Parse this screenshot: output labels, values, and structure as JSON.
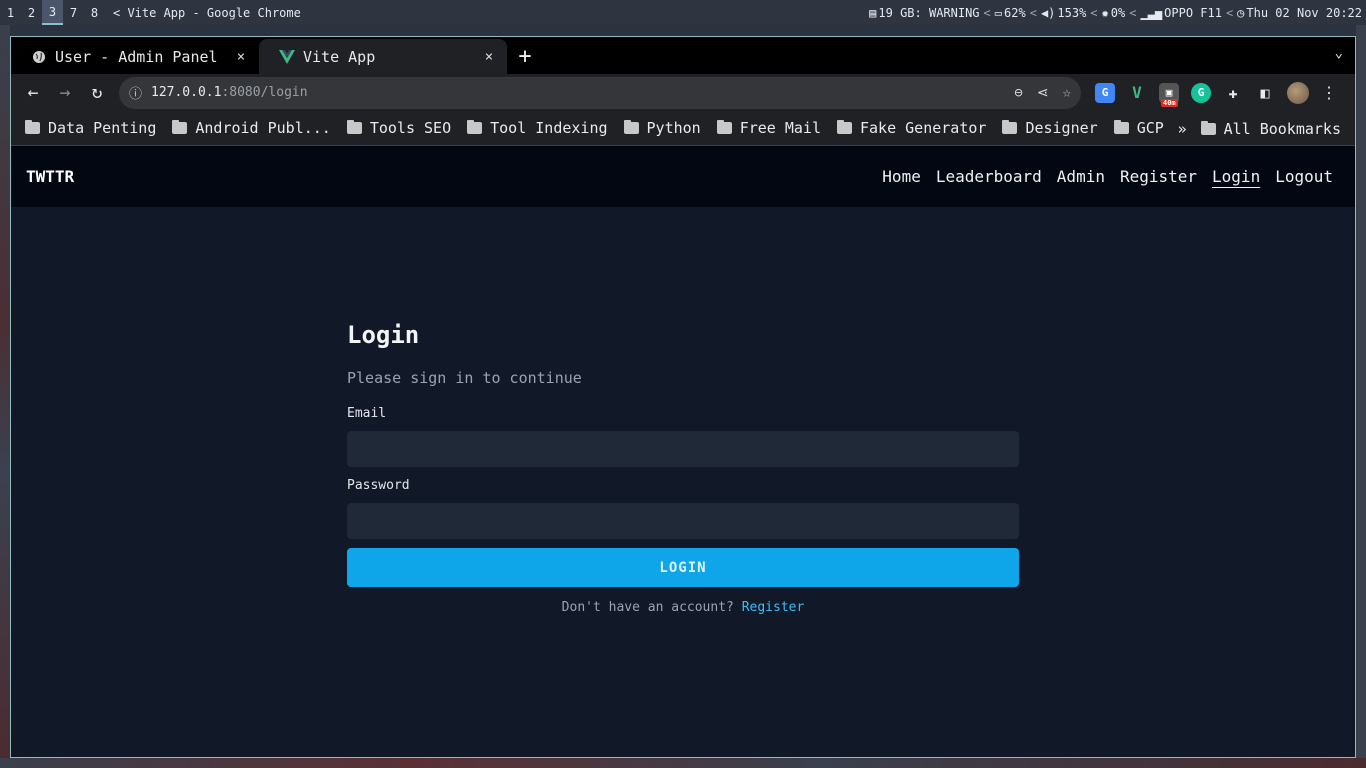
{
  "system_bar": {
    "workspaces": [
      "1",
      "2",
      "3",
      "7",
      "8"
    ],
    "active_workspace": "3",
    "window_title": "< Vite App - Google Chrome",
    "disk": "19 GB: WARNING",
    "battery": "62%",
    "volume": "153%",
    "brightness": "0%",
    "network": "OPPO F11",
    "clock": "Thu 02 Nov 20:22",
    "separator": "<"
  },
  "browser": {
    "tabs": [
      {
        "title": "User - Admin Panel",
        "icon": "globe-icon",
        "close": "×"
      },
      {
        "title": "Vite App",
        "icon": "vue-logo-icon",
        "close": "×"
      }
    ],
    "new_tab": "+",
    "url_host": "127.0.0.1",
    "url_rest": ":8080/login",
    "extension_badge": "40m",
    "bookmarks": [
      "Data Penting",
      "Android Publ...",
      "Tools SEO",
      "Tool Indexing",
      "Python",
      "Free Mail",
      "Fake Generator",
      "Designer",
      "GCP"
    ],
    "bookmarks_overflow": "»",
    "all_bookmarks": "All Bookmarks"
  },
  "app": {
    "brand": "TWTTR",
    "nav": [
      "Home",
      "Leaderboard",
      "Admin",
      "Register",
      "Login",
      "Logout"
    ],
    "active_nav": "Login",
    "login": {
      "title": "Login",
      "subtitle": "Please sign in to continue",
      "email_label": "Email",
      "email_value": "",
      "password_label": "Password",
      "password_value": "",
      "button": "LOGIN",
      "footer_text": "Don't have an account?",
      "footer_link": "Register"
    }
  },
  "colors": {
    "page_bg": "#111827",
    "navbar_bg": "#030712",
    "input_bg": "#1f2937",
    "button_bg": "#0ea5e9",
    "link": "#38bdf8"
  }
}
